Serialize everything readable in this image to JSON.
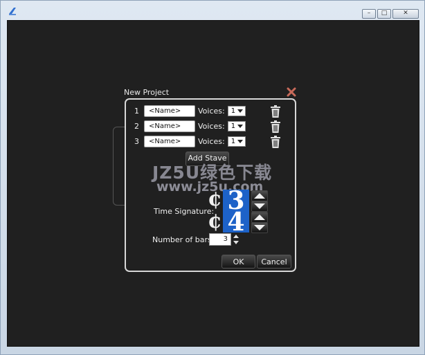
{
  "window": {
    "minimize_glyph": "–",
    "maximize_glyph": "□",
    "close_glyph": "✕",
    "accent_color": "#1d62c8"
  },
  "dialog": {
    "title": "New Project",
    "staves": [
      {
        "number": "1",
        "name_value": "<Name>",
        "voices_label": "Voices:",
        "voices_value": "1"
      },
      {
        "number": "2",
        "name_value": "<Name>",
        "voices_label": "Voices:",
        "voices_value": "1"
      },
      {
        "number": "3",
        "name_value": "<Name>",
        "voices_label": "Voices:",
        "voices_value": "1"
      }
    ],
    "add_stave_label": "Add Stave",
    "time_signature_label": "Time Signature:",
    "time_signature": {
      "numerator": "3",
      "denominator": "4",
      "symbol_glyph": "¢"
    },
    "number_of_bars_label": "Number of bars:",
    "number_of_bars_value": "3",
    "ok_label": "OK",
    "cancel_label": "Cancel"
  },
  "watermark": {
    "line1": "JZ5U绿色下载",
    "line2": "www.jz5u.com"
  }
}
